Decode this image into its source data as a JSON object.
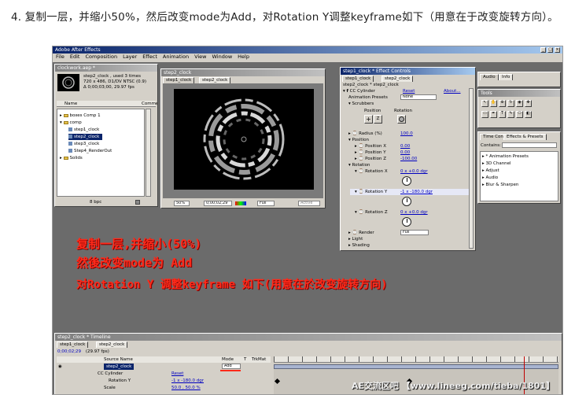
{
  "caption": "4. 复制一层，并缩小50%，然后改变mode为Add，对Rotation Y调整keyframe如下（用意在于改变旋转方向）。",
  "app": {
    "title": "Adobe After Effects",
    "menu": [
      "File",
      "Edit",
      "Composition",
      "Layer",
      "Effect",
      "Animation",
      "View",
      "Window",
      "Help"
    ]
  },
  "project": {
    "title": "clockwork.aep *",
    "info_name": "step2_clock , used 3 times",
    "info_line2": "720 x 486, D1/DV NTSC (0.9)",
    "info_line3": "Δ 0;00;03;00, 29.97 fps",
    "col_name": "Name",
    "col_comment": "Comme",
    "items": [
      {
        "label": "boxes Comp 1",
        "type": "folder"
      },
      {
        "label": "comp",
        "type": "folder"
      },
      {
        "label": "step1_clock",
        "type": "comp"
      },
      {
        "label": "step2_clock",
        "type": "comp",
        "selected": true
      },
      {
        "label": "step3_clock",
        "type": "comp"
      },
      {
        "label": "Step4_RenderOut",
        "type": "comp"
      },
      {
        "label": "Solids",
        "type": "folder"
      }
    ],
    "bpc": "8 bpc"
  },
  "comp_window": {
    "title": "step2_clock",
    "tabs": [
      "step1_clock",
      "step2_clock"
    ],
    "zoom": "50%",
    "timecode": "0;00;02;29",
    "resolution": "Full",
    "active": "Active"
  },
  "effect_controls": {
    "title": "step1_clock * Effect Controls",
    "tabs": [
      "step1_clock",
      "step2_clock"
    ],
    "layer_path": "step2_clock * step2_clock",
    "effect_name": "CC Cylinder",
    "reset": "Reset",
    "about": "About...",
    "anim_presets_label": "Animation Presets",
    "anim_presets_value": "None",
    "scrubbers_label": "Scrubbers",
    "position_btn": "Position",
    "rotation_btn": "Rotation",
    "radius_label": "Radius (%)",
    "radius_value": "100.0",
    "position_label": "Position",
    "pos_x_label": "Position X",
    "pos_x_value": "0.00",
    "pos_y_label": "Position Y",
    "pos_y_value": "0.00",
    "pos_z_label": "Position Z",
    "pos_z_value": "-100.00",
    "rotation_label": "Rotation",
    "rot_x_label": "Rotation X",
    "rot_x_value": "0 x +0.0 dgr",
    "rot_y_label": "Rotation Y",
    "rot_y_value": "-1 x -180.0 dgr",
    "rot_z_label": "Rotation Z",
    "rot_z_value": "0 x +0.0 dgr",
    "render_label": "Render",
    "render_value": "Full",
    "light_label": "Light",
    "shading_label": "Shading"
  },
  "info_palette": {
    "tabs": [
      "Audio",
      "Info"
    ]
  },
  "tools_palette": {
    "title": "Tools"
  },
  "effects_palette": {
    "tabs": [
      "Time Cont",
      "Effects & Presets"
    ],
    "contains_label": "Contains:",
    "items": [
      "* Animation Presets",
      "3D Channel",
      "Adjust",
      "Audio",
      "Blur & Sharpen"
    ]
  },
  "overlay": {
    "line1": "复制一层,并缩小(50%)",
    "line2": "然後改变mode为 Add",
    "line3": "对Rotation Y 调整keyframe 如下(用意在於改变旋转方向)"
  },
  "timeline": {
    "title": "step2_clock * Timeline",
    "tabs": [
      "step1_clock",
      "step2_clock"
    ],
    "timecode": "0;00;02;29",
    "fps": "(29.97 fps)",
    "col_source": "Source Name",
    "col_mode": "Mode",
    "col_t": "T",
    "col_trkmat": "TrkMat",
    "layer1_name": "step2_clock",
    "layer1_mode": "Add",
    "effect_row": "CC Cylinder",
    "effect_reset": "Reset",
    "rot_y_row": "Rotation Y",
    "rot_y_value": "-1 x -180.0 dgr",
    "scale_row": "Scale",
    "scale_value": "50.0 , 50.0 %"
  },
  "watermark": "AE交流区吧 【www.lineeg.com/tieba/1801】",
  "colors": {
    "overlay_red": "#ff2a1a",
    "title_blue": "#0a246a",
    "panel_gray": "#d4d0c8"
  }
}
